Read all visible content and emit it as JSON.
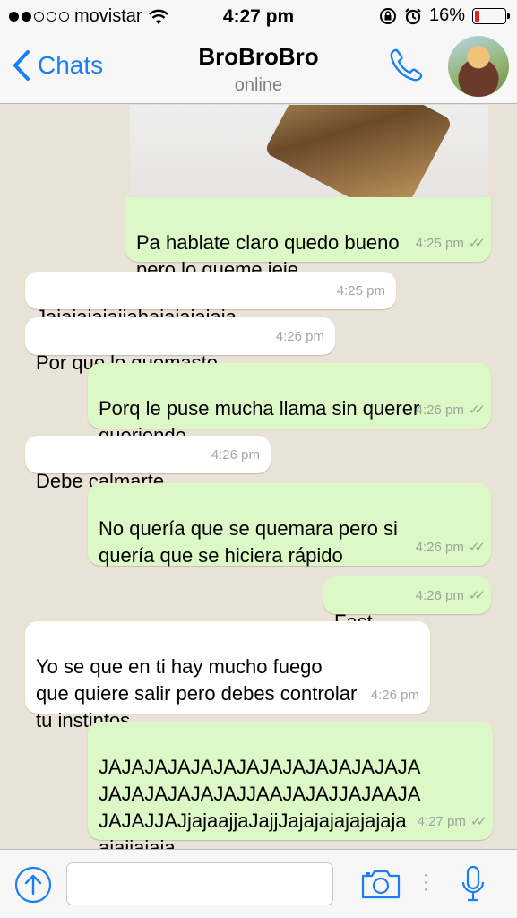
{
  "status_bar": {
    "carrier": "movistar",
    "time": "4:27 pm",
    "battery": "16%",
    "battery_level": 0.16,
    "signal_bars_filled": 2,
    "signal_bars_total": 5
  },
  "nav": {
    "back_label": "Chats",
    "contact_name": "BroBroBro",
    "contact_status": "online"
  },
  "messages": [
    {
      "direction": "out",
      "text": "Pa hablate claro quedo bueno\npero lo queme jeje",
      "time": "4:25 pm",
      "read": true
    },
    {
      "direction": "in",
      "text": "Jajajajajajjahajajajajaja",
      "time": "4:25 pm"
    },
    {
      "direction": "in",
      "text": "Por que lo quemaste",
      "time": "4:26 pm"
    },
    {
      "direction": "out",
      "text": "Porq le puse mucha llama sin querer\nqueriendo",
      "time": "4:26 pm",
      "read": true
    },
    {
      "direction": "in",
      "text": "Debe calmarte",
      "time": "4:26 pm"
    },
    {
      "direction": "out",
      "text": "No quería que se quemara pero si\nquería que se hiciera rápido",
      "time": "4:26 pm",
      "read": true
    },
    {
      "direction": "out",
      "text": "Fast",
      "time": "4:26 pm",
      "read": true
    },
    {
      "direction": "in",
      "text": "Yo se que en ti hay mucho fuego\nque quiere salir pero debes controlar\ntu instintos",
      "time": "4:26 pm"
    },
    {
      "direction": "out",
      "text": "JAJAJAJAJAJAJAJAJAJAJAJAJAJA\nJAJAJAJAJAJAJJAAJAJAJJAJAAJA\nJAJAJJAJjajaajjaJajjJajajajajajajaja\najajjajaja",
      "time": "4:27 pm",
      "read": true
    }
  ],
  "input": {
    "placeholder": ""
  },
  "icons": {
    "back": "chevron-left-icon",
    "call": "phone-icon",
    "attach": "upload-arrow-icon",
    "camera": "camera-icon",
    "mic": "microphone-icon",
    "wifi": "wifi-icon",
    "lock": "rotation-lock-icon",
    "alarm": "alarm-icon"
  },
  "colors": {
    "accent": "#1a7ef5",
    "outgoing_bubble": "#dcf8c6",
    "incoming_bubble": "#ffffff",
    "chat_background": "#e9e2d6",
    "battery_low": "#e0241a"
  }
}
